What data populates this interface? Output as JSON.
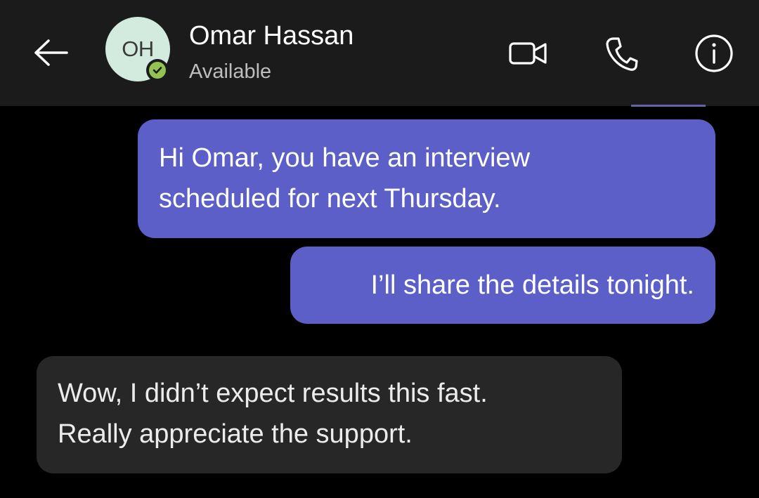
{
  "header": {
    "back_icon": "arrow-left-icon",
    "avatar_initials": "OH",
    "presence_icon": "available-check-icon",
    "presence_color": "#92c353",
    "contact_name": "Omar Hassan",
    "contact_status": "Available",
    "actions": [
      {
        "icon": "video-camera-icon"
      },
      {
        "icon": "phone-icon"
      },
      {
        "icon": "info-icon"
      }
    ]
  },
  "colors": {
    "header_bg": "#1b1b1b",
    "outgoing_bubble": "#5b5fc7",
    "incoming_bubble": "#272727",
    "avatar_bg": "#d3eade"
  },
  "messages": [
    {
      "direction": "outgoing",
      "lines": [
        "Hi Omar, you have an interview",
        "scheduled for next Thursday."
      ]
    },
    {
      "direction": "outgoing",
      "lines": [
        "I’ll share the details tonight."
      ]
    },
    {
      "direction": "incoming",
      "lines": [
        "Wow, I didn’t expect results this fast.",
        "Really appreciate the support."
      ]
    }
  ]
}
